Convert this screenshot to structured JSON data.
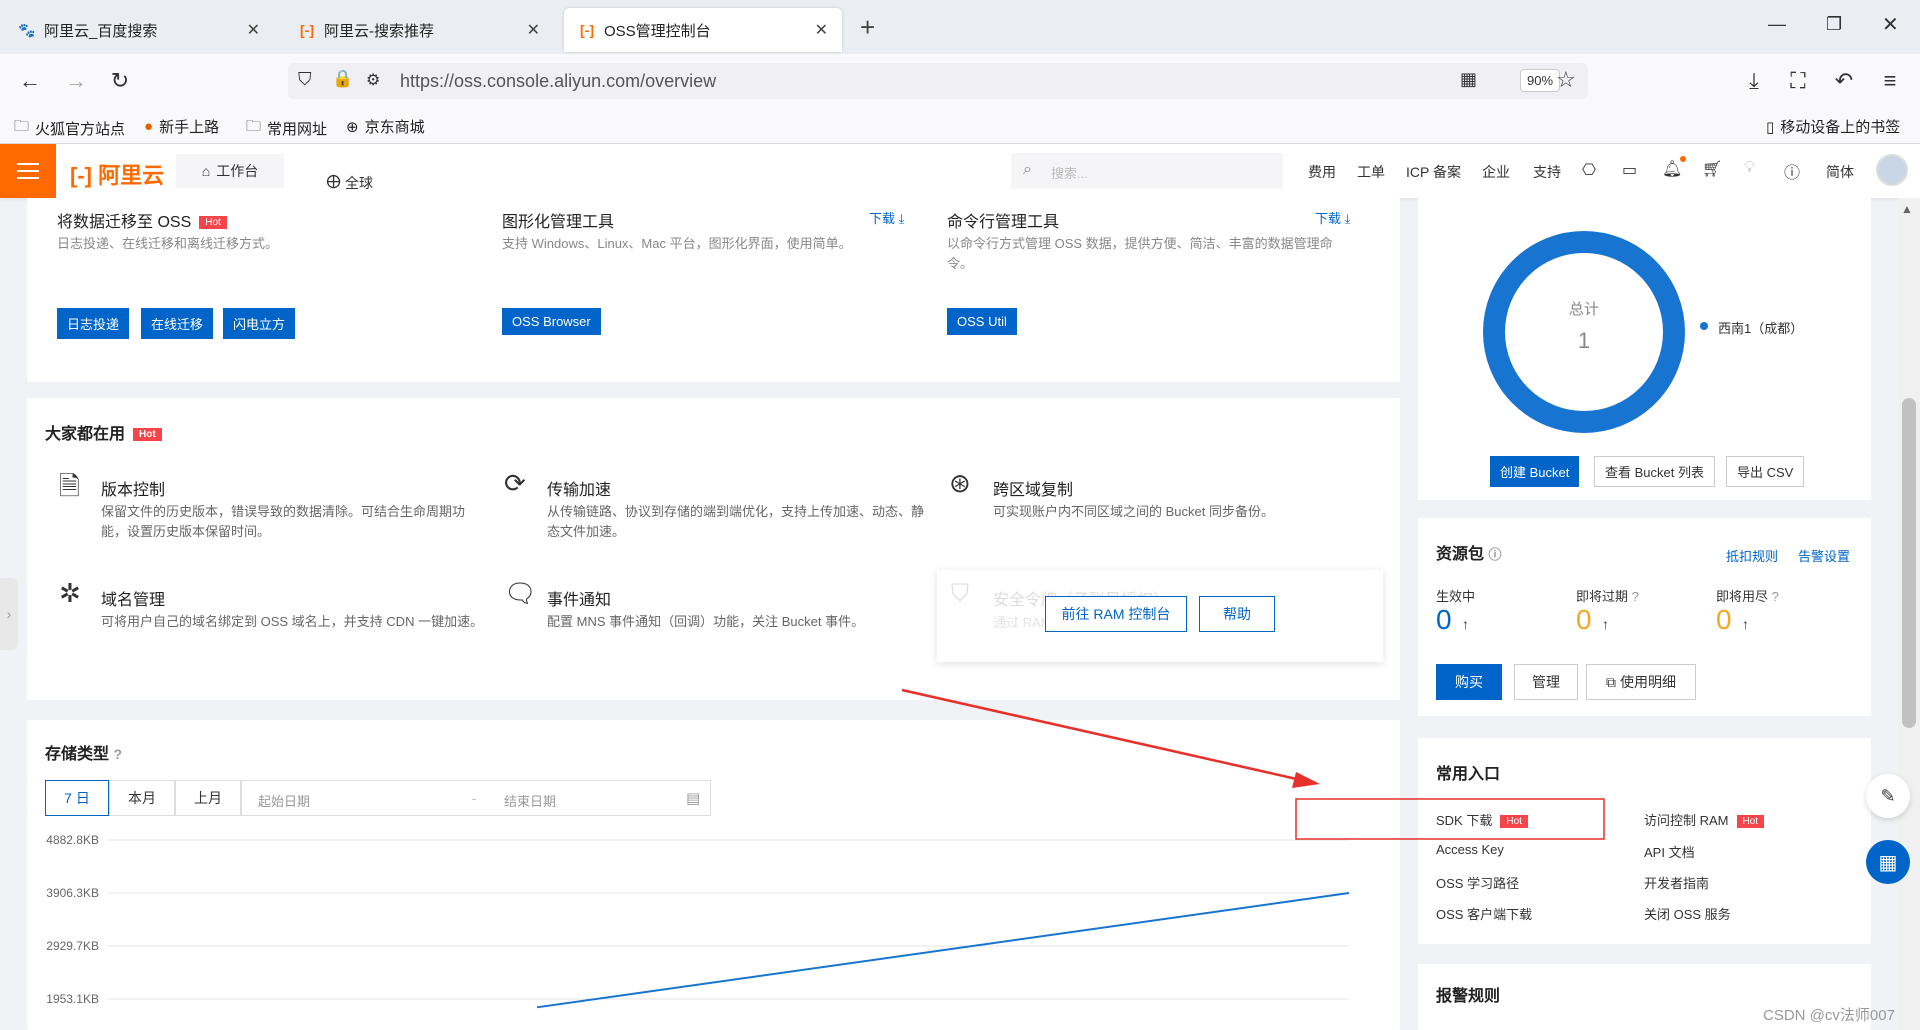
{
  "browser": {
    "tabs": [
      {
        "label": "阿里云_百度搜索",
        "icon": "baidu-paw-icon"
      },
      {
        "label": "阿里云-搜索推荐",
        "icon": "aliyun-icon"
      },
      {
        "label": "OSS管理控制台",
        "icon": "aliyun-icon"
      }
    ],
    "new_tab": "+",
    "url": "https://oss.console.aliyun.com/overview",
    "zoom": "90%",
    "bookmarks": [
      "火狐官方站点",
      "新手上路",
      "常用网址",
      "京东商城"
    ],
    "mobile_bookmarks": "移动设备上的书签"
  },
  "topnav": {
    "logo": "阿里云",
    "workbench": "工作台",
    "region": "全球",
    "search_placeholder": "搜索...",
    "items": [
      "费用",
      "工单",
      "ICP 备案",
      "企业",
      "支持"
    ],
    "lang": "简体"
  },
  "tools": {
    "migrate": {
      "title": "将数据迁移至 OSS",
      "hot": "Hot",
      "desc": "日志投递、在线迁移和离线迁移方式。",
      "buttons": [
        "日志投递",
        "在线迁移",
        "闪电立方"
      ]
    },
    "gui": {
      "title": "图形化管理工具",
      "download": "下载",
      "desc": "支持 Windows、Linux、Mac 平台，图形化界面，使用简单。",
      "button": "OSS Browser"
    },
    "cli": {
      "title": "命令行管理工具",
      "download": "下载",
      "desc": "以命令行方式管理 OSS 数据，提供方便、简洁、丰富的数据管理命令。",
      "button": "OSS Util"
    }
  },
  "popular": {
    "title": "大家都在用",
    "hot": "Hot",
    "items": [
      {
        "title": "版本控制",
        "desc": "保留文件的历史版本，错误导致的数据清除。可结合生命周期功能，设置历史版本保留时间。"
      },
      {
        "title": "传输加速",
        "desc": "从传输链路、协议到存储的端到端优化，支持上传加速、动态、静态文件加速。"
      },
      {
        "title": "跨区域复制",
        "desc": "可实现账户内不同区域之间的 Bucket 同步备份。"
      },
      {
        "title": "域名管理",
        "desc": "可将用户自己的域名绑定到 OSS 域名上，并支持 CDN 一键加速。"
      },
      {
        "title": "事件通知",
        "desc": "配置 MNS 事件通知（回调）功能，关注 Bucket 事件。"
      },
      {
        "title": "安全令牌（子账号授权）",
        "desc": "通过 RAM"
      }
    ],
    "ram_button": "前往 RAM 控制台",
    "help_button": "帮助"
  },
  "storage": {
    "title": "存储类型",
    "ranges": [
      "7 日",
      "本月",
      "上月"
    ],
    "start_placeholder": "起始日期",
    "sep": "-",
    "end_placeholder": "结束日期"
  },
  "chart_data": {
    "type": "line",
    "y_ticks": [
      "4882.8KB",
      "3906.3KB",
      "2929.7KB",
      "1953.1KB"
    ],
    "series": [
      {
        "values": [
          1800,
          3906.3
        ]
      }
    ]
  },
  "bucket": {
    "total_label": "总计",
    "total": "1",
    "legend": "西南1（成都）",
    "color": "#1774d0",
    "buttons": [
      "创建 Bucket",
      "查看 Bucket 列表",
      "导出 CSV"
    ]
  },
  "resource": {
    "title": "资源包",
    "links": [
      "抵扣规则",
      "告警设置"
    ],
    "stats": [
      {
        "label": "生效中",
        "value": "0",
        "arrow": "↑",
        "color": "#0064c8"
      },
      {
        "label": "即将过期",
        "value": "0",
        "arrow": "↑",
        "color": "#f5a623"
      },
      {
        "label": "即将用尽",
        "value": "0",
        "arrow": "↑",
        "color": "#f5a623"
      }
    ],
    "buttons": [
      "购买",
      "管理",
      "使用明细"
    ]
  },
  "entries": {
    "title": "常用入口",
    "hot": "Hot",
    "left": [
      "SDK 下载",
      "Access Key",
      "OSS 学习路径",
      "OSS 客户端下载"
    ],
    "right": [
      "访问控制 RAM",
      "API 文档",
      "开发者指南",
      "关闭 OSS 服务"
    ]
  },
  "alarm": {
    "title": "报警规则"
  },
  "watermark": "CSDN @cv法师007"
}
